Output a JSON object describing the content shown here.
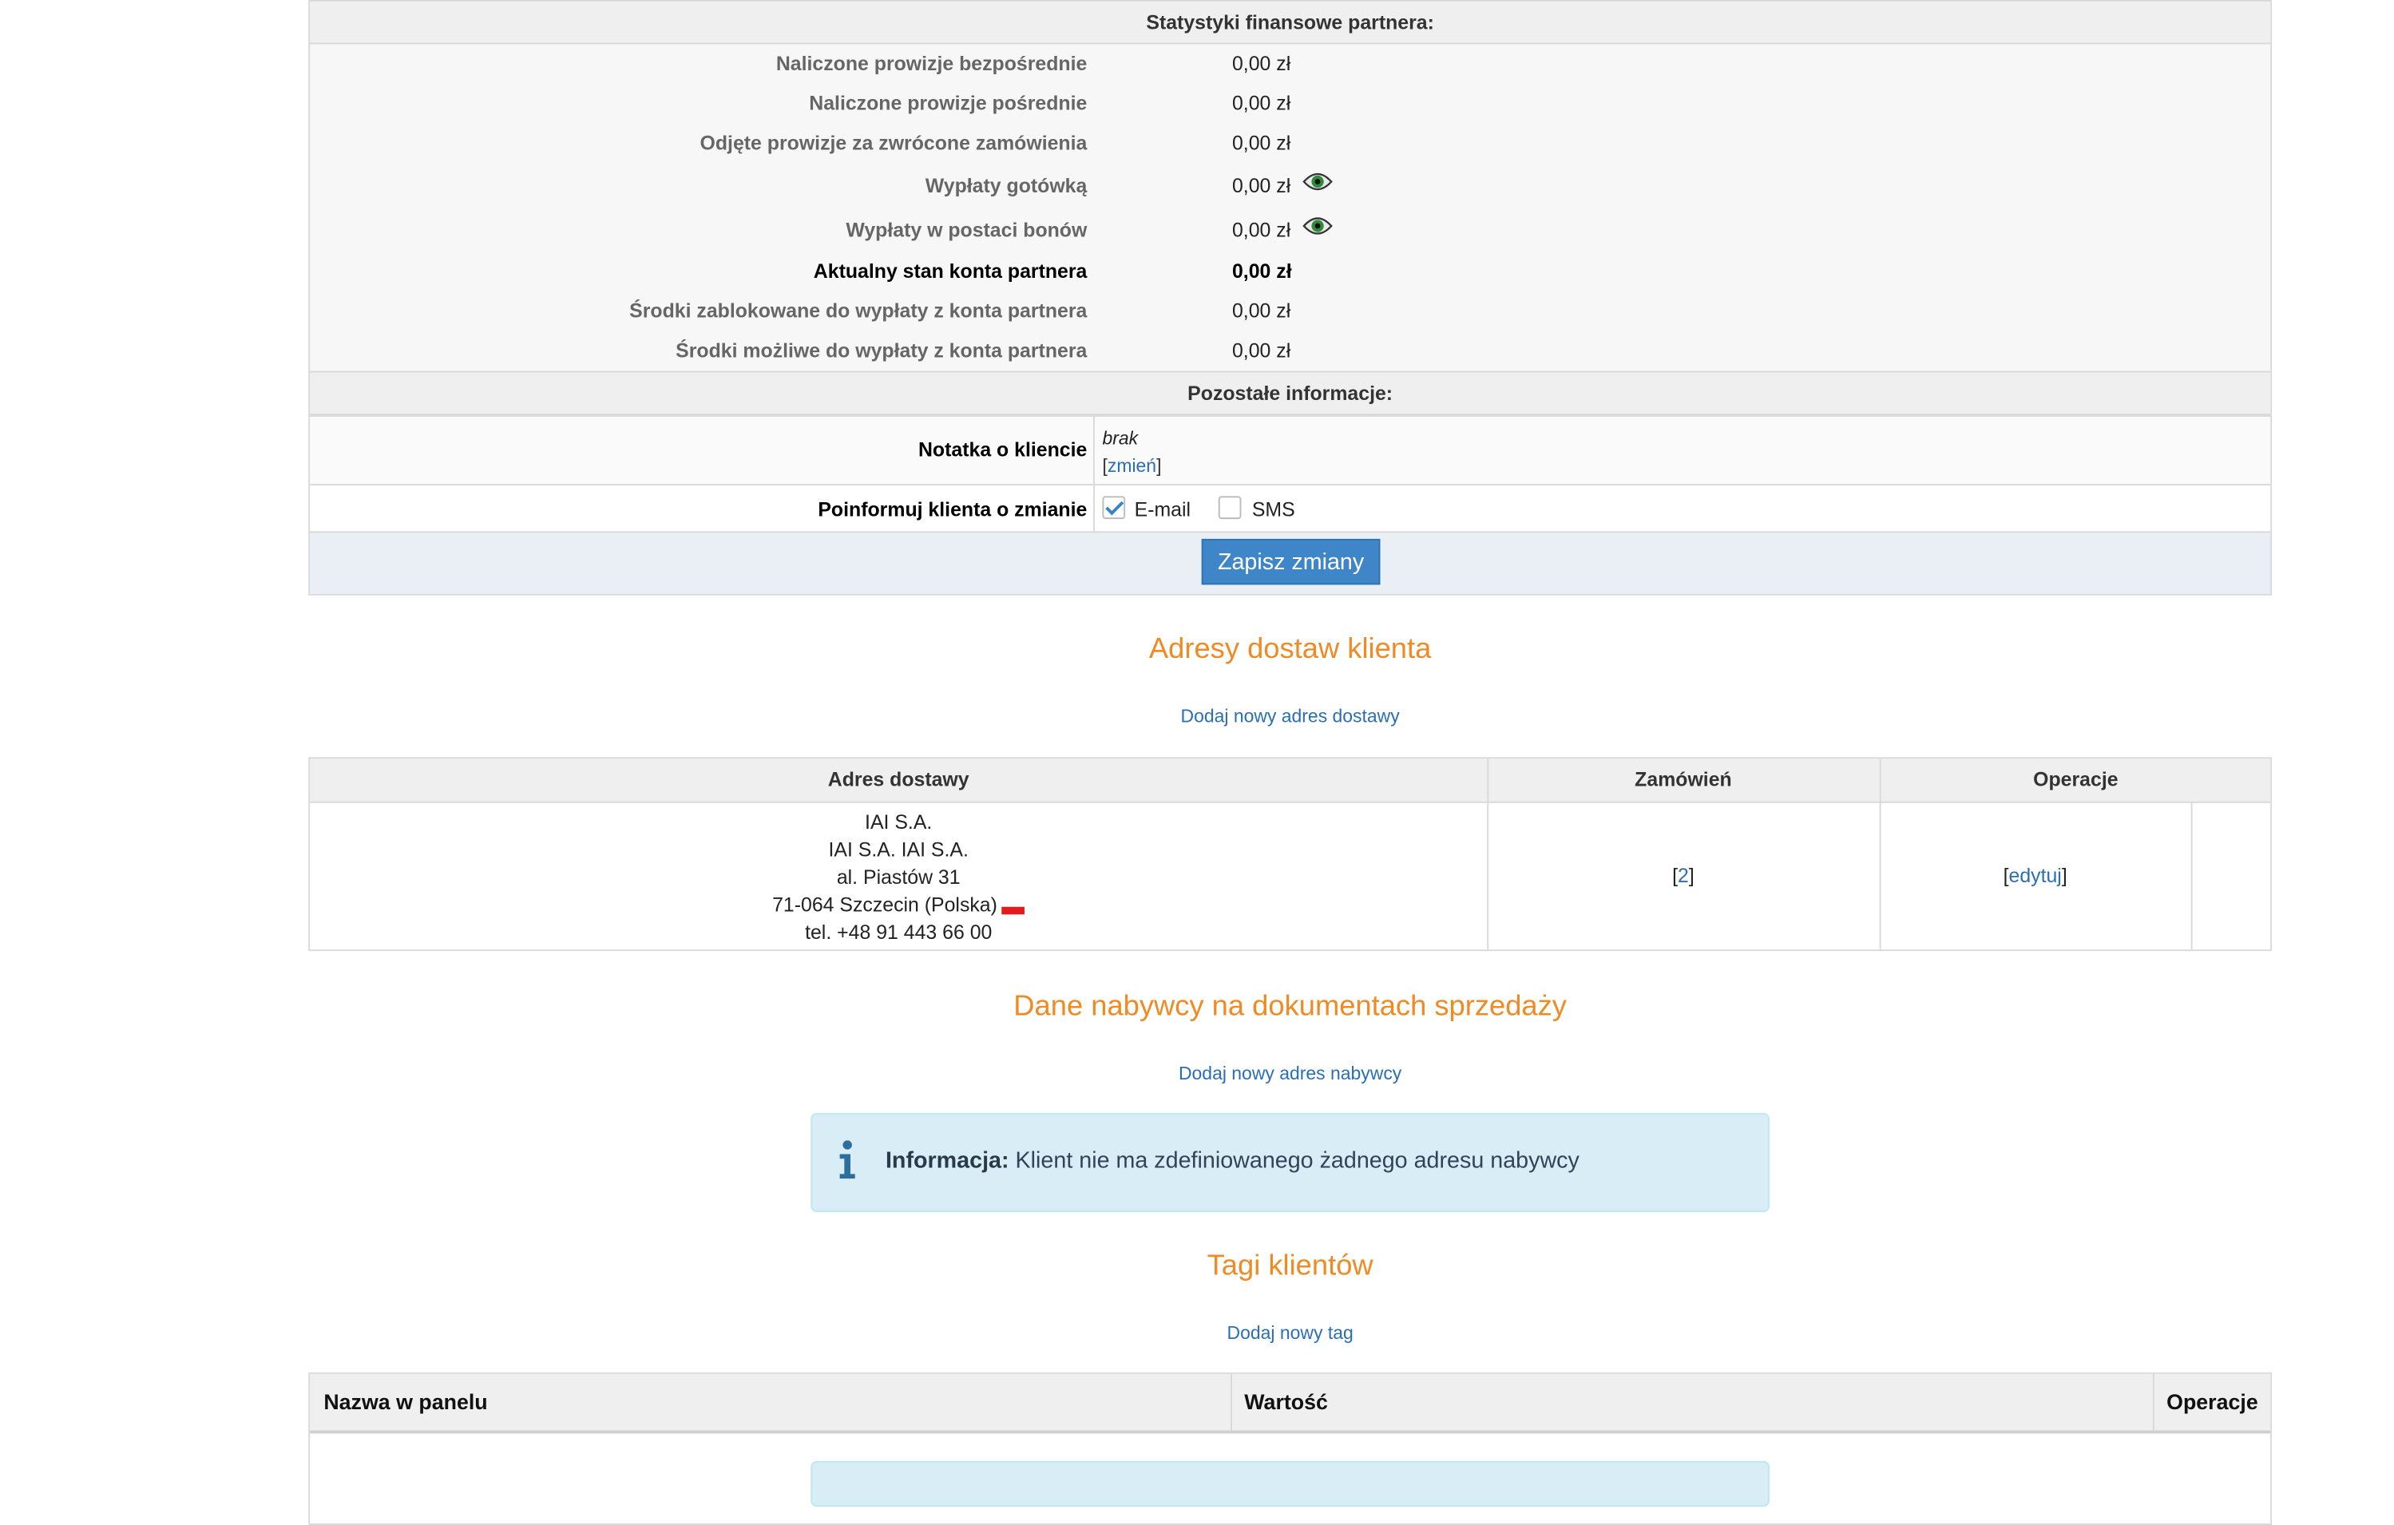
{
  "finance": {
    "header": "Statystyki finansowe partnera:",
    "rows": [
      {
        "label": "Naliczone prowizje bezpośrednie",
        "value": "0,00 zł"
      },
      {
        "label": "Naliczone prowizje pośrednie",
        "value": "0,00 zł"
      },
      {
        "label": "Odjęte prowizje za zwrócone zamówienia",
        "value": "0,00 zł"
      },
      {
        "label": "Wypłaty gotówką",
        "value": "0,00 zł"
      },
      {
        "label": "Wypłaty w postaci bonów",
        "value": "0,00 zł"
      },
      {
        "label": "Aktualny stan konta partnera",
        "value": "0,00 zł"
      },
      {
        "label": "Środki zablokowane do wypłaty z konta partnera",
        "value": "0,00 zł"
      },
      {
        "label": "Środki możliwe do wypłaty z konta partnera",
        "value": "0,00 zł"
      }
    ]
  },
  "other": {
    "header": "Pozostałe informacje:",
    "note_label": "Notatka o kliencie",
    "note_value": "brak",
    "note_link": "zmień",
    "notify_label": "Poinformuj klienta o zmianie",
    "email_label": "E-mail",
    "email_checked": true,
    "sms_label": "SMS",
    "sms_checked": false,
    "save_button": "Zapisz zmiany"
  },
  "addresses": {
    "title": "Adresy dostaw klienta",
    "add_link": "Dodaj nowy adres dostawy",
    "columns": [
      "Adres dostawy",
      "Zamówień",
      "Operacje"
    ],
    "rows": [
      {
        "lines": [
          "IAI S.A.",
          "IAI S.A. IAI S.A.",
          "al. Piastów 31",
          "71-064 Szczecin (Polska)",
          "tel. +48 91 443 66 00"
        ],
        "orders": "2",
        "operation": "edytuj"
      }
    ]
  },
  "buyer": {
    "title": "Dane nabywcy na dokumentach sprzedaży",
    "add_link": "Dodaj nowy adres nabywcy",
    "info_label": "Informacja:",
    "info_text": "Klient nie ma zdefiniowanego żadnego adresu nabywcy"
  },
  "tags": {
    "title": "Tagi klientów",
    "add_link": "Dodaj nowy tag",
    "columns": [
      "Nazwa w panelu",
      "Wartość",
      "Operacje"
    ]
  },
  "colors": {
    "accent_orange": "#f08a24",
    "link_blue": "#2a6fb5",
    "button_blue": "#3e86c8",
    "info_bg": "#d9edf7"
  }
}
